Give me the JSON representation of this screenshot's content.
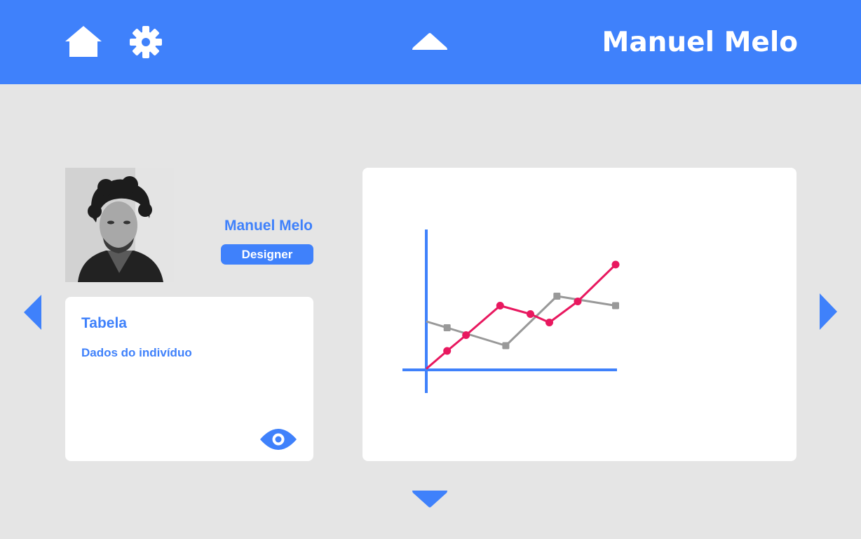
{
  "header": {
    "user_name": "Manuel Melo",
    "bar_color": "#3f81fb",
    "icons": [
      "home-icon",
      "gear-icon",
      "chevron-up-icon"
    ]
  },
  "profile": {
    "name": "Manuel Melo",
    "role": "Designer",
    "avatar": "avatar-photo"
  },
  "card": {
    "title": "Tabela",
    "subtitle": "Dados do indivíduo",
    "action_icon": "eye-icon"
  },
  "navigation": {
    "icons": [
      "chevron-left-icon",
      "chevron-right-icon",
      "chevron-down-icon"
    ]
  },
  "colors": {
    "accent": "#3f81fb",
    "background": "#e5e5e5",
    "series_red": "#e8185f",
    "series_gray": "#999999"
  },
  "chart_data": {
    "type": "line",
    "title": "",
    "xlabel": "",
    "ylabel": "",
    "grid": false,
    "legend": "none",
    "xlim": [
      0,
      10
    ],
    "ylim": [
      0,
      10
    ],
    "series": [
      {
        "color": "#e8185f",
        "marker": "circle",
        "points": [
          [
            0,
            0.1
          ],
          [
            1.1,
            1.8
          ],
          [
            2.1,
            3.3
          ],
          [
            3.9,
            6.1
          ],
          [
            5.5,
            5.3
          ],
          [
            6.5,
            4.5
          ],
          [
            8.0,
            6.5
          ],
          [
            10.0,
            10.0
          ]
        ]
      },
      {
        "color": "#999999",
        "marker": "square",
        "points": [
          [
            0,
            4.6
          ],
          [
            1.1,
            4.0
          ],
          [
            4.2,
            2.3
          ],
          [
            6.9,
            7.0
          ],
          [
            10.0,
            6.1
          ]
        ]
      }
    ]
  }
}
